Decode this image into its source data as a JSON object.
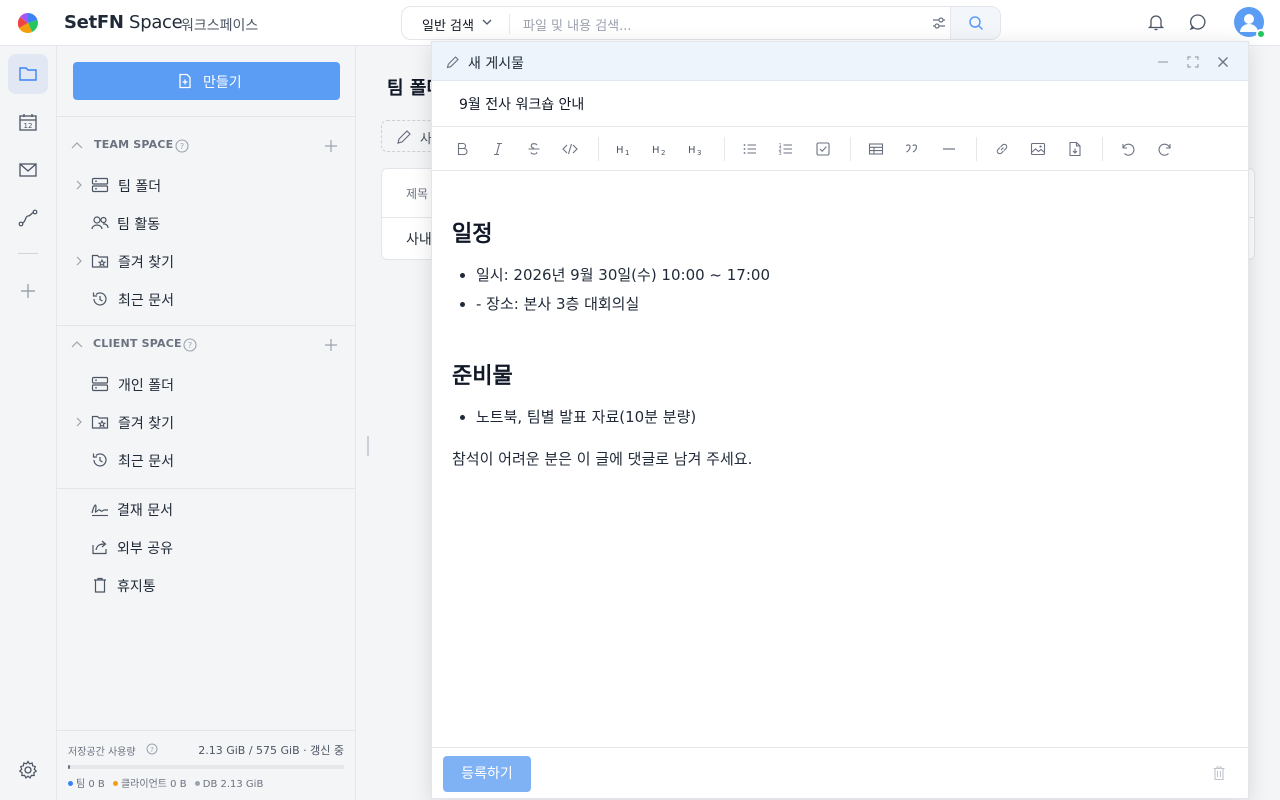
{
  "app": {
    "brand_main": "SetFN",
    "brand_sub": " Space",
    "workspace": "워크스페이스"
  },
  "search": {
    "mode": "일반 검색",
    "placeholder": "파일 및 내용 검색..."
  },
  "rail": {
    "items": [
      "folder-icon",
      "calendar-icon",
      "mail-icon",
      "workflow-icon",
      "plus-icon"
    ],
    "settings_icon": "gear-icon"
  },
  "sidebar": {
    "create_label": "만들기",
    "team_space": {
      "label": "TEAM SPACE",
      "items": [
        {
          "label": "팀 폴더",
          "icon": "server-icon",
          "expandable": true
        },
        {
          "label": "팀 활동",
          "icon": "team-icon",
          "expandable": false
        },
        {
          "label": "즐겨 찾기",
          "icon": "star-folder-icon",
          "expandable": true
        },
        {
          "label": "최근 문서",
          "icon": "history-icon",
          "expandable": false
        }
      ]
    },
    "client_space": {
      "label": "CLIENT SPACE",
      "items": [
        {
          "label": "개인 폴더",
          "icon": "server-icon",
          "expandable": false
        },
        {
          "label": "즐겨 찾기",
          "icon": "star-folder-icon",
          "expandable": true
        },
        {
          "label": "최근 문서",
          "icon": "history-icon",
          "expandable": false
        }
      ]
    },
    "extra_items": [
      {
        "label": "결재 문서",
        "icon": "signature-icon"
      },
      {
        "label": "외부 공유",
        "icon": "share-icon"
      },
      {
        "label": "휴지통",
        "icon": "trash-icon"
      }
    ],
    "storage": {
      "label": "저장공간 사용량",
      "usage": "2.13 GiB / 575 GiB · 갱신 중",
      "used_fraction": 0.004,
      "legend_team": "팀 0 B",
      "legend_client": "클라이언트 0 B",
      "legend_db": "DB 2.13 GiB",
      "color_team": "#3b82f6",
      "color_client": "#f59e0b",
      "color_db": "#9ca3af"
    }
  },
  "content": {
    "title": "팀 폴더",
    "pill": "사",
    "table_header": "제목",
    "table_row": "사내"
  },
  "modal": {
    "title": "새 게시물",
    "subject": "9월 전사 워크숍 안내",
    "toolbar": [
      "bold-icon",
      "italic-icon",
      "strikethrough-icon",
      "code-icon",
      "h1-icon",
      "h2-icon",
      "h3-icon",
      "bullet-list-icon",
      "ordered-list-icon",
      "task-list-icon",
      "table-icon",
      "quote-icon",
      "horizontal-rule-icon",
      "link-icon",
      "image-icon",
      "attachment-icon",
      "undo-icon",
      "redo-icon"
    ],
    "body": {
      "heading1": "일정",
      "list1": [
        "일시: 2026년 9월 30일(수) 10:00 ~ 17:00",
        "- 장소: 본사 3층 대회의실"
      ],
      "heading2": "준비물",
      "list2": [
        "노트북, 팀별 발표 자료(10분 분량)"
      ],
      "paragraph": "참석이 어려운 분은 이 글에 댓글로 남겨 주세요."
    },
    "submit_label": "등록하기"
  },
  "colors": {
    "accent": "#5b9cf5",
    "submit_disabled": "#7fb2f5",
    "online": "#22c55e"
  }
}
